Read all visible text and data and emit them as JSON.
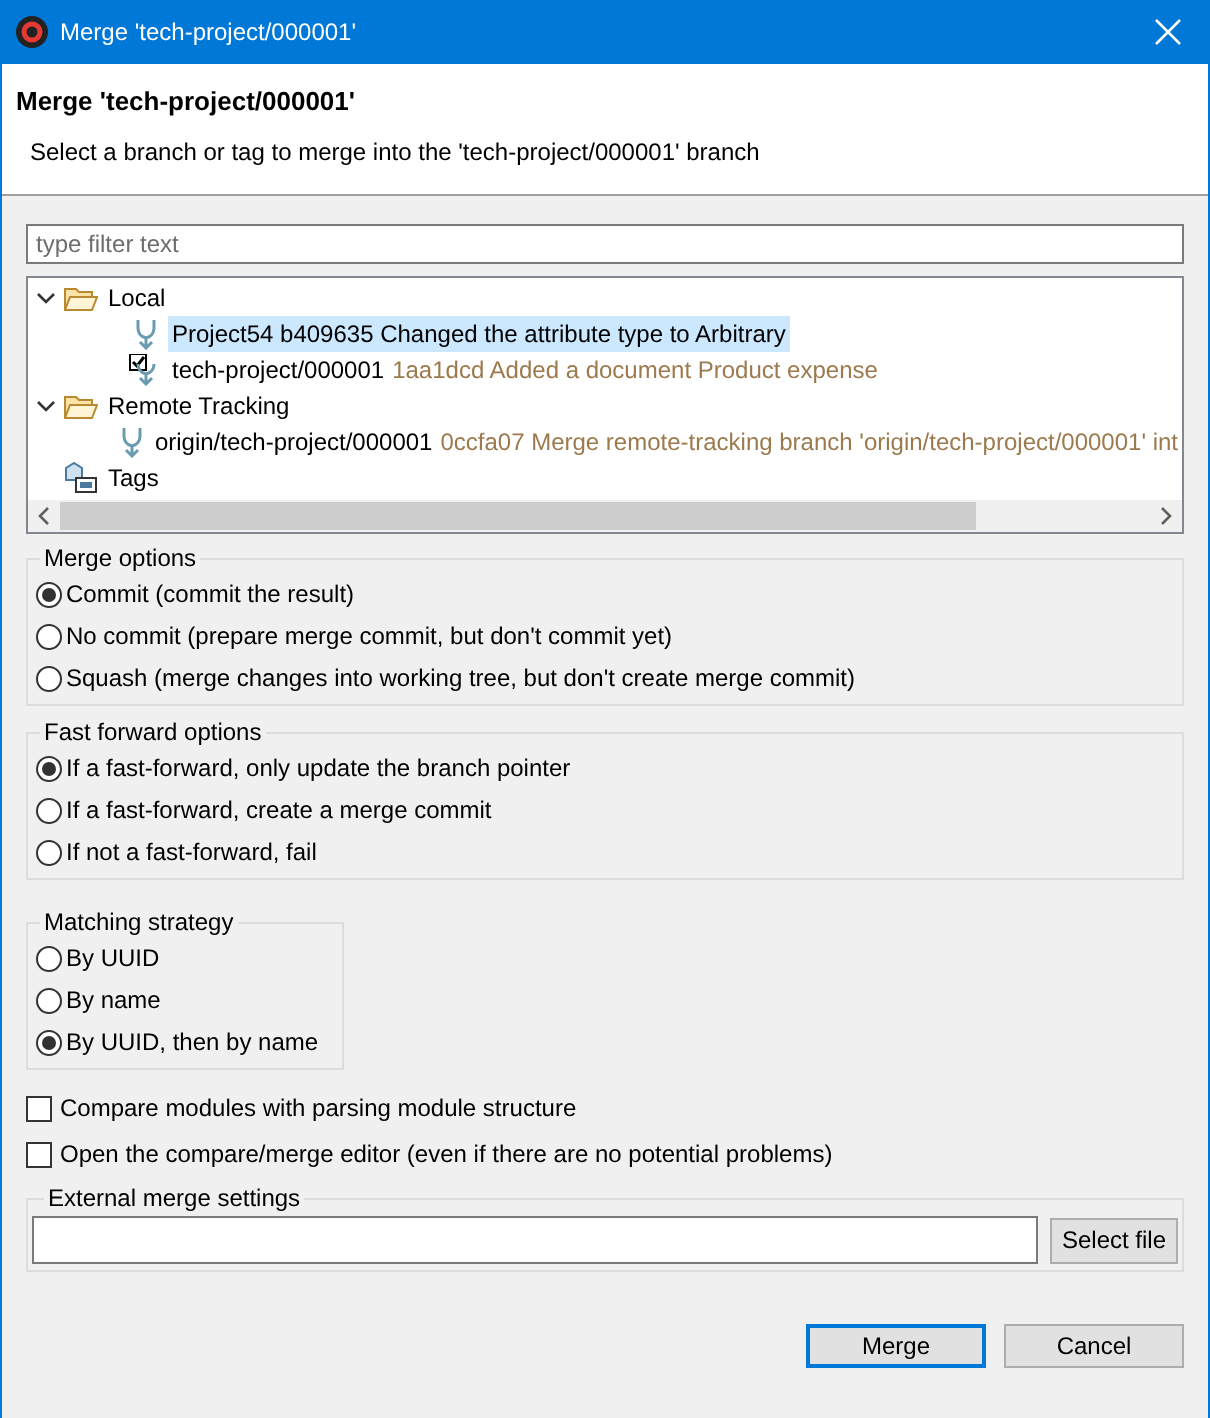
{
  "window": {
    "title": "Merge 'tech-project/000001'"
  },
  "header": {
    "title": "Merge 'tech-project/000001'",
    "description": "Select a branch or tag to merge into the 'tech-project/000001' branch"
  },
  "filter": {
    "placeholder": "type filter text"
  },
  "tree": [
    {
      "kind": "folder",
      "label": "Local",
      "expanded": true,
      "selected": false,
      "children": [
        {
          "kind": "branch",
          "label": "Project54 b409635 Changed the attribute type to Arbitrary",
          "selected": true
        },
        {
          "kind": "checked-out-branch",
          "label": "tech-project/000001",
          "detail": "1aa1dcd Added a document Product expense",
          "selected": false
        }
      ]
    },
    {
      "kind": "folder",
      "label": "Remote Tracking",
      "expanded": true,
      "selected": false,
      "children": [
        {
          "kind": "branch",
          "label": "origin/tech-project/000001",
          "detail": "0ccfa07 Merge remote-tracking branch 'origin/tech-project/000001' int",
          "selected": false
        }
      ]
    },
    {
      "kind": "tags",
      "label": "Tags",
      "selected": false
    }
  ],
  "groups": [
    {
      "title": "Merge options",
      "options": [
        {
          "label": "Commit (commit the result)",
          "selected": true
        },
        {
          "label": "No commit (prepare merge commit, but don't commit yet)",
          "selected": false
        },
        {
          "label": "Squash (merge changes into working tree, but don't create merge commit)",
          "selected": false
        }
      ]
    },
    {
      "title": "Fast forward options",
      "options": [
        {
          "label": "If a fast-forward, only update the branch pointer",
          "selected": true
        },
        {
          "label": "If a fast-forward, create a merge commit",
          "selected": false
        },
        {
          "label": "If not a fast-forward, fail",
          "selected": false
        }
      ]
    },
    {
      "title": "Matching strategy",
      "options": [
        {
          "label": "By UUID",
          "selected": false
        },
        {
          "label": "By name",
          "selected": false
        },
        {
          "label": "By UUID, then by name",
          "selected": true
        }
      ]
    }
  ],
  "checkboxes": [
    {
      "label": "Compare modules with parsing module structure",
      "checked": false
    },
    {
      "label": "Open the compare/merge editor (even if there are no potential problems)",
      "checked": false
    }
  ],
  "external": {
    "title": "External merge settings",
    "button": "Select file"
  },
  "buttons": [
    {
      "label": "Merge",
      "default": true
    },
    {
      "label": "Cancel",
      "default": false
    }
  ]
}
